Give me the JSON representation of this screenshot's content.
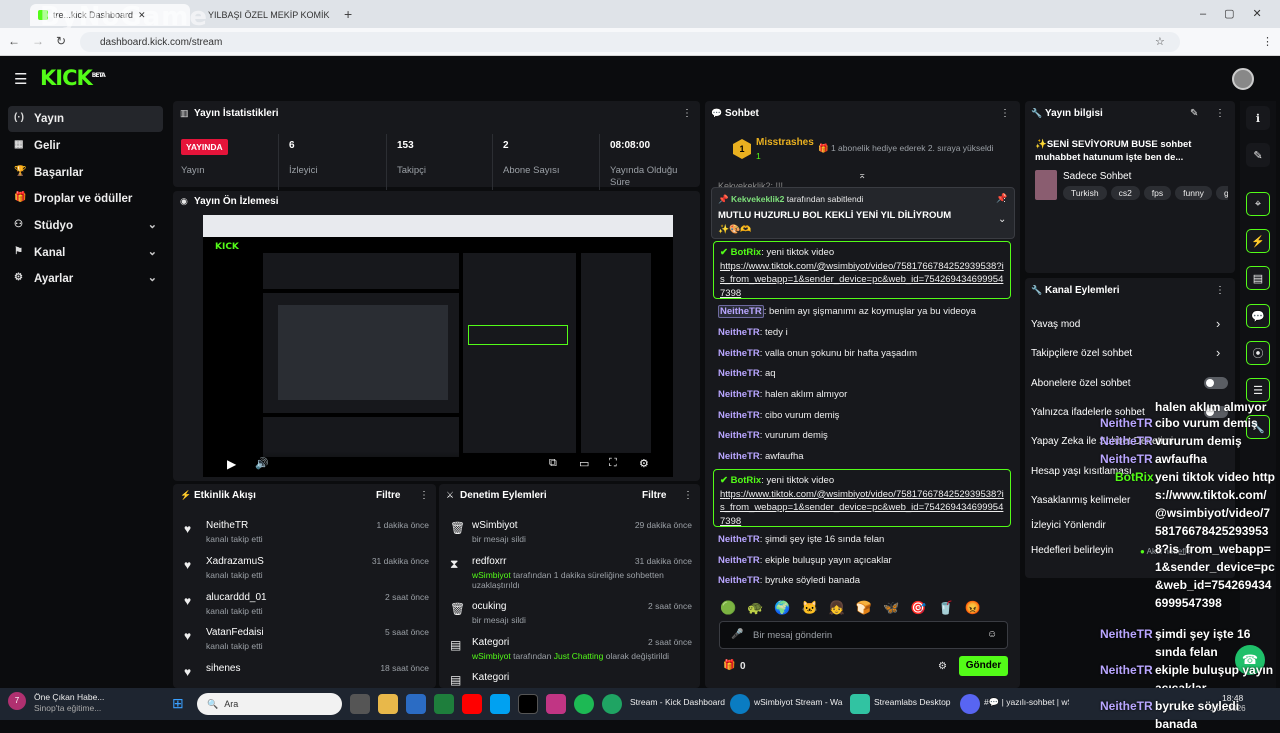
{
  "browser": {
    "tab1": "tre...kick Dashboard",
    "tab2": "YILBAŞI ÖZEL MEKİP KOMİK",
    "new_tab": "+",
    "url": "dashboard.kick.com/stream",
    "watermark": "ByNoGame"
  },
  "sidebar": {
    "items": [
      {
        "label": "Yayın",
        "icon": "(·)"
      },
      {
        "label": "Gelir",
        "icon": "▦"
      },
      {
        "label": "Başarılar",
        "icon": "🏆"
      },
      {
        "label": "Droplar ve ödüller",
        "icon": "🎁"
      },
      {
        "label": "Stüdyo",
        "icon": "⚇"
      },
      {
        "label": "Kanal",
        "icon": "⚑"
      },
      {
        "label": "Ayarlar",
        "icon": "⚙"
      }
    ]
  },
  "stats": {
    "title": "Yayın İstatistikleri",
    "live_badge": "YAYINDA",
    "live_label": "Yayın",
    "viewers": "6",
    "viewers_label": "İzleyici",
    "followers": "153",
    "followers_label": "Takipçi",
    "subs": "2",
    "subs_label": "Abone Sayısı",
    "uptime": "08:08:00",
    "uptime_label": "Yayında Olduğu Süre"
  },
  "preview": {
    "title": "Yayın Ön İzlemesi"
  },
  "activity": {
    "title": "Etkinlik Akışı",
    "filter": "Filtre",
    "items": [
      {
        "name": "NeitheTR",
        "sub": "kanalı takip etti",
        "time": "1 dakika önce"
      },
      {
        "name": "XadrazamuS",
        "sub": "kanalı takip etti",
        "time": "31 dakika önce"
      },
      {
        "name": "alucarddd_01",
        "sub": "kanalı takip etti",
        "time": "2 saat önce"
      },
      {
        "name": "VatanFedaisi",
        "sub": "kanalı takip etti",
        "time": "5 saat önce"
      },
      {
        "name": "sihenes",
        "sub": "kanalı takip etti",
        "time": "18 saat önce"
      }
    ]
  },
  "moderation": {
    "title": "Denetim Eylemleri",
    "filter": "Filtre",
    "items": [
      {
        "name": "wSimbiyot",
        "sub": "bir mesajı sildi",
        "time": "29 dakika önce",
        "icon": "🗑"
      },
      {
        "name": "redfoxrr",
        "actor": "wSimbiyot",
        "sub": "tarafından 1 dakika süreliğine sohbetten uzaklaştırıldı",
        "time": "31 dakika önce",
        "icon": "⧗"
      },
      {
        "name": "ocuking",
        "sub": "bir mesajı sildi",
        "time": "2 saat önce",
        "icon": "🗑"
      },
      {
        "name": "Kategori",
        "actor": "wSimbiyot",
        "sub": "tarafından",
        "cat": "Just Chatting",
        "sub2": "olarak değiştirildi",
        "time": "2 saat önce",
        "icon": "▤"
      },
      {
        "name": "Kategori",
        "time": "",
        "icon": "▤"
      }
    ]
  },
  "chat": {
    "title": "Sohbet",
    "top_gifter": "Misstrashes",
    "top_gifter_rank": "1",
    "gift_text": "1 abonelik hediye ederek 2. sıraya yükseldi",
    "partial_user": "Kekvekeklik2: !!!",
    "pin_by": "Kekvekeklik2",
    "pin_suffix": "tarafından sabitlendi",
    "pin_text": "MUTLU HUZURLU BOL KEKLİ YENİ YIL DİLİYROUM",
    "bot": "BotRix",
    "bot_text": "yeni tiktok video",
    "bot_link": "https://www.tiktok.com/@wsimbiyot/video/7581766784252939538?is_from_webapp=1&sender_device=pc&web_id=7542694346999547398",
    "messages": [
      {
        "user": "NeitheTR",
        "text": "benim ayı şişmanımı az koymuşlar ya bu videoya"
      },
      {
        "user": "NeitheTR",
        "text": "tedy i"
      },
      {
        "user": "NeitheTR",
        "text": "valla onun şokunu bir hafta yaşadım"
      },
      {
        "user": "NeitheTR",
        "text": "aq"
      },
      {
        "user": "NeitheTR",
        "text": "halen aklım almıyor"
      },
      {
        "user": "NeitheTR",
        "text": "cibo vurum demiş"
      },
      {
        "user": "NeitheTR",
        "text": "vururum demiş"
      },
      {
        "user": "NeitheTR",
        "text": "awfaufha"
      }
    ],
    "messages2": [
      {
        "user": "NeitheTR",
        "text": "şimdi şey işte 16 sında felan"
      },
      {
        "user": "NeitheTR",
        "text": "ekiple buluşup yayın açıcaklar"
      },
      {
        "user": "NeitheTR",
        "text": "byruke söyledi banada"
      }
    ],
    "input_placeholder": "Bir mesaj gönderin",
    "count": "0",
    "send": "Gönder"
  },
  "stream_info": {
    "title": "Yayın bilgisi",
    "stream_title": "✨SENİ SEVİYORUM BUSE sohbet muhabbet hatunum işte ben de...",
    "category": "Sadece Sohbet",
    "tags": [
      "Turkish",
      "cs2",
      "fps",
      "funny",
      "gam"
    ]
  },
  "channel_actions": {
    "title": "Kanal Eylemleri",
    "items": [
      "Yavaş mod",
      "Takipçilere özel sohbet",
      "Abonelere özel sohbet",
      "Yalnızca ifadelerle sohbet",
      "Yapay Zeka ile Sohbet Denetimi",
      "Hesap yaşı kısıtlaması",
      "Yasaklanmış kelimeler",
      "İzleyici Yönlendir",
      "Hedefleri belirleyin"
    ],
    "goal_hint": "Aktif hedefler - 2"
  },
  "overlay": {
    "lines": [
      {
        "user": "NeitheTR",
        "text": "cibo vurum demiş"
      },
      {
        "user": "NeitheTR",
        "text": "vururum demiş"
      },
      {
        "user": "NeitheTR",
        "text": "awfaufha"
      },
      {
        "user": "BotRix",
        "text": "yeni tiktok video https://www.tiktok.com/@wsimbiyot/video/7581766784252939538?is_from_webapp=1&sender_device=pc&web_id=7542694346999547398"
      },
      {
        "user": "NeitheTR",
        "text": "şimdi şey işte 16 sında felan"
      },
      {
        "user": "NeitheTR",
        "text": "ekiple buluşup yayın açıcaklar"
      },
      {
        "user": "NeitheTR",
        "text": "byruke söyledi banada"
      }
    ],
    "partial_top": "halen aklım almıyor"
  },
  "taskbar": {
    "news": "Öne Çıkan Habe...",
    "news_sub": "Sinop'ta eğitime...",
    "search": "Ara",
    "apps": [
      "Stream - Kick Dashboard",
      "wSimbiyot Stream - Wa",
      "Streamlabs Desktop",
      "#💬 | yazılı-sohbet | wS"
    ],
    "time": "18:48",
    "date": "1.01.2026"
  },
  "colors": {
    "kick_green": "#53fc18",
    "live_red": "#e5143a",
    "panel": "#17181c",
    "name_purple": "#b9a6ff"
  }
}
